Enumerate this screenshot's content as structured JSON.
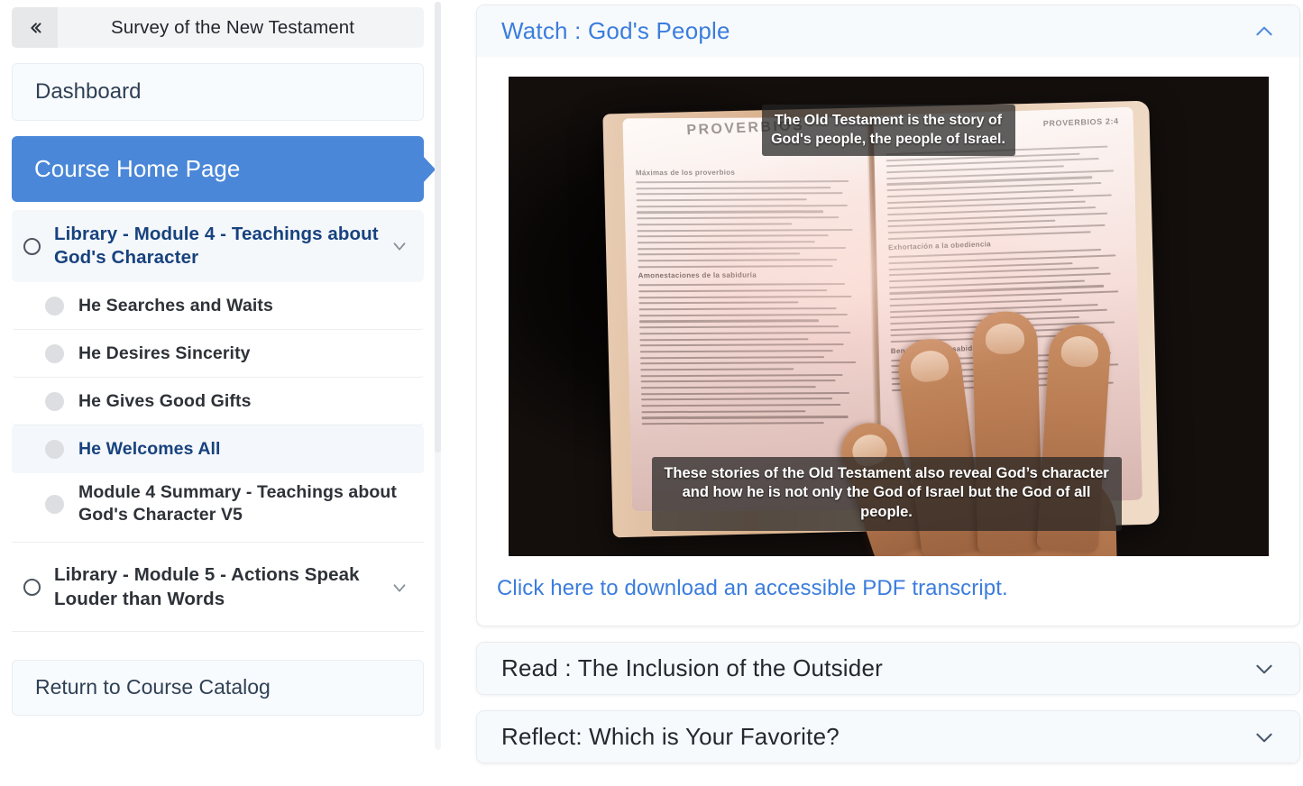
{
  "sidebar": {
    "collapse_icon": "double-chevron-left-icon",
    "course_title": "Survey of the New Testament",
    "dashboard_label": "Dashboard",
    "home_label": "Course Home Page",
    "catalog_label": "Return to Course Catalog",
    "modules": [
      {
        "label": "Library - Module 4 - Teachings about God's Character",
        "active": true,
        "expanded": true,
        "icon": "circle-outline-icon",
        "chevron": "chevron-down-icon",
        "items": [
          {
            "label": "He Searches and Waits",
            "active": false
          },
          {
            "label": "He Desires Sincerity",
            "active": false
          },
          {
            "label": "He Gives Good Gifts",
            "active": false
          },
          {
            "label": "He Welcomes All",
            "active": true
          },
          {
            "label": "Module 4 Summary - Teachings about God's Character V5",
            "active": false
          }
        ]
      },
      {
        "label": "Library - Module 5 - Actions Speak Louder than Words",
        "active": false,
        "expanded": false,
        "icon": "circle-outline-icon",
        "chevron": "chevron-down-icon",
        "items": []
      }
    ]
  },
  "main": {
    "sections": [
      {
        "title": "Watch : God's People",
        "expanded": true,
        "icon": "chevron-up-icon",
        "video": {
          "caption_top": "The Old Testament is the story of God's people, the people of Israel.",
          "caption_bottom": "These stories of the Old Testament also reveal God’s character and how he is not only the God of Israel but the God of all people.",
          "page_heading": "PROVERBIOS",
          "page_reference": "PROVERBIOS 2:4",
          "col_headings": [
            "Máximas de los proverbios",
            "Amonestaciones de la sabiduría",
            "Exhortación a la obediencia",
            "Beneficios de la sabiduría"
          ]
        },
        "transcript_label": "Click here to download an accessible PDF transcript."
      },
      {
        "title": "Read : The Inclusion of the Outsider",
        "expanded": false,
        "icon": "chevron-down-icon"
      },
      {
        "title": "Reflect: Which is Your Favorite?",
        "expanded": false,
        "icon": "chevron-down-icon"
      }
    ]
  },
  "colors": {
    "accent_blue": "#4a87d8",
    "link_blue": "#3b7ddd",
    "active_nav": "#17427e",
    "panel_bg": "#f7fafc"
  }
}
